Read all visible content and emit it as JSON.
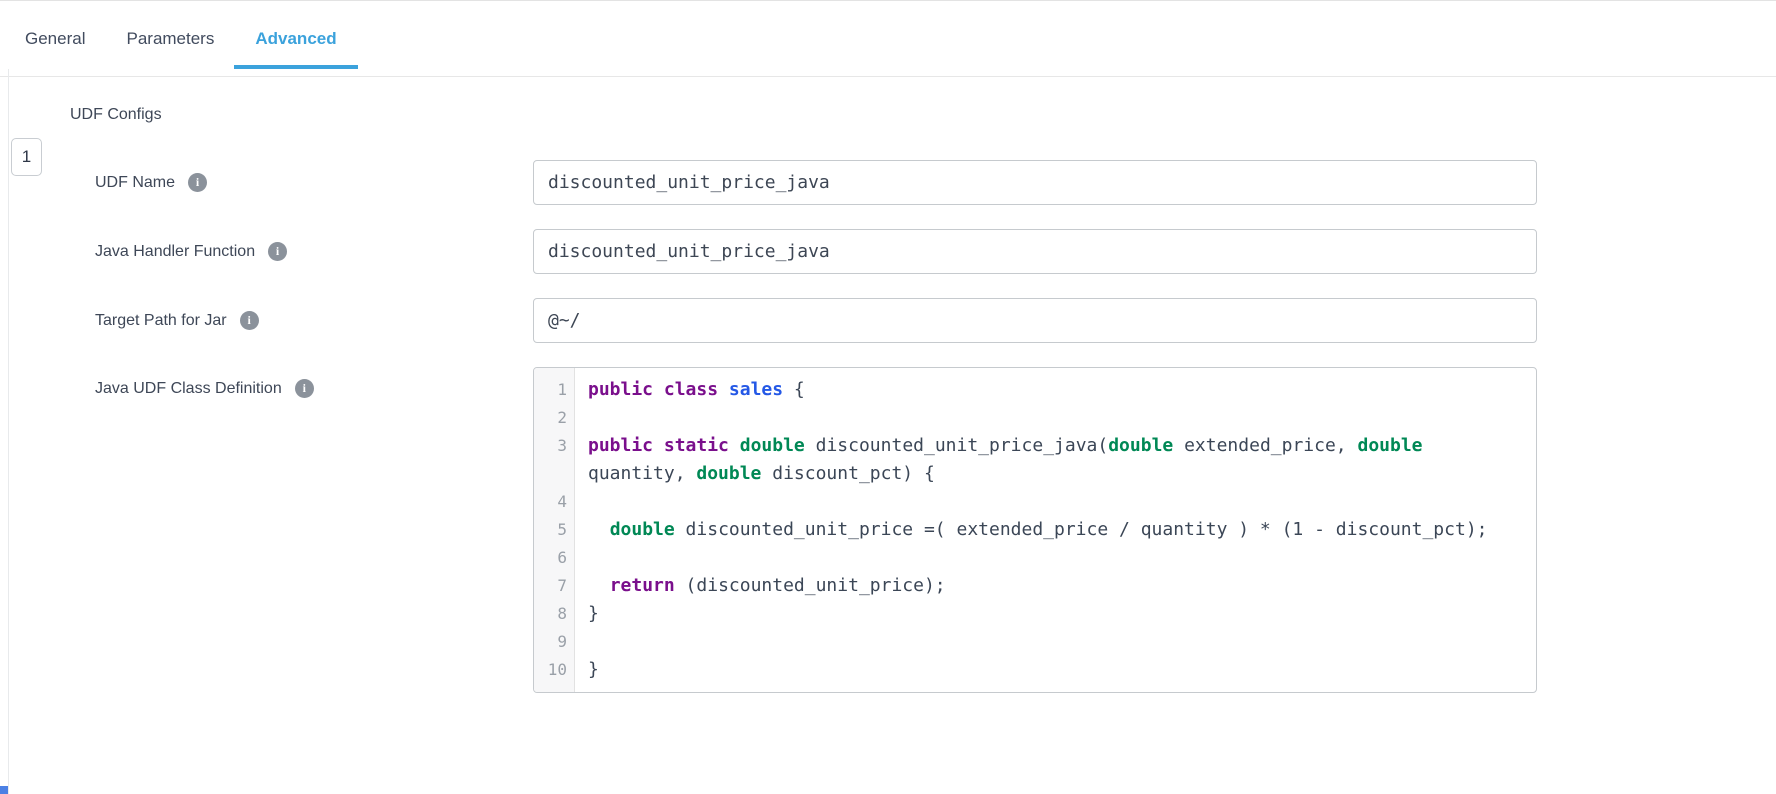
{
  "colors": {
    "accent": "#3ba2dc",
    "keyword": "#7a0f8c",
    "type_green": "#008855",
    "def_blue": "#2458e6",
    "code_text": "#3b4656"
  },
  "icons": {
    "info": "i"
  },
  "tabs": {
    "items": [
      {
        "label": "General",
        "active": false
      },
      {
        "label": "Parameters",
        "active": false
      },
      {
        "label": "Advanced",
        "active": true
      }
    ]
  },
  "section": {
    "title": "UDF Configs",
    "index_badge": "1"
  },
  "fields": [
    {
      "label": "UDF Name",
      "type": "input",
      "value": "discounted_unit_price_java",
      "has_info": true
    },
    {
      "label": "Java Handler Function",
      "type": "input",
      "value": "discounted_unit_price_java",
      "has_info": true
    },
    {
      "label": "Target Path for Jar",
      "type": "input",
      "value": "@~/",
      "has_info": true
    },
    {
      "label": "Java UDF Class Definition",
      "type": "code",
      "has_info": true
    }
  ],
  "code_editor": {
    "lines": [
      {
        "num": 1,
        "tokens": [
          {
            "c": "kw",
            "text": "public"
          },
          {
            "c": "pl",
            "text": " "
          },
          {
            "c": "kw",
            "text": "class"
          },
          {
            "c": "pl",
            "text": " "
          },
          {
            "c": "def",
            "text": "sales"
          },
          {
            "c": "pl",
            "text": " {"
          }
        ]
      },
      {
        "num": 2,
        "tokens": []
      },
      {
        "num": 3,
        "tokens": [
          {
            "c": "kw",
            "text": "public"
          },
          {
            "c": "pl",
            "text": " "
          },
          {
            "c": "kw",
            "text": "static"
          },
          {
            "c": "pl",
            "text": " "
          },
          {
            "c": "ty",
            "text": "double"
          },
          {
            "c": "pl",
            "text": " discounted_unit_price_java("
          },
          {
            "c": "ty",
            "text": "double"
          },
          {
            "c": "pl",
            "text": " extended_price, "
          },
          {
            "c": "ty",
            "text": "double"
          },
          {
            "c": "pl",
            "text": " quantity, "
          },
          {
            "c": "ty",
            "text": "double"
          },
          {
            "c": "pl",
            "text": " discount_pct) {"
          }
        ]
      },
      {
        "num": 4,
        "tokens": []
      },
      {
        "num": 5,
        "tokens": [
          {
            "c": "pl",
            "text": "  "
          },
          {
            "c": "ty",
            "text": "double"
          },
          {
            "c": "pl",
            "text": " discounted_unit_price =( extended_price / quantity ) * (1 - discount_pct);"
          }
        ]
      },
      {
        "num": 6,
        "tokens": []
      },
      {
        "num": 7,
        "tokens": [
          {
            "c": "pl",
            "text": "  "
          },
          {
            "c": "kw",
            "text": "return"
          },
          {
            "c": "pl",
            "text": " (discounted_unit_price);"
          }
        ]
      },
      {
        "num": 8,
        "tokens": [
          {
            "c": "pl",
            "text": "}"
          }
        ]
      },
      {
        "num": 9,
        "tokens": []
      },
      {
        "num": 10,
        "tokens": [
          {
            "c": "pl",
            "text": "}"
          }
        ]
      }
    ]
  }
}
